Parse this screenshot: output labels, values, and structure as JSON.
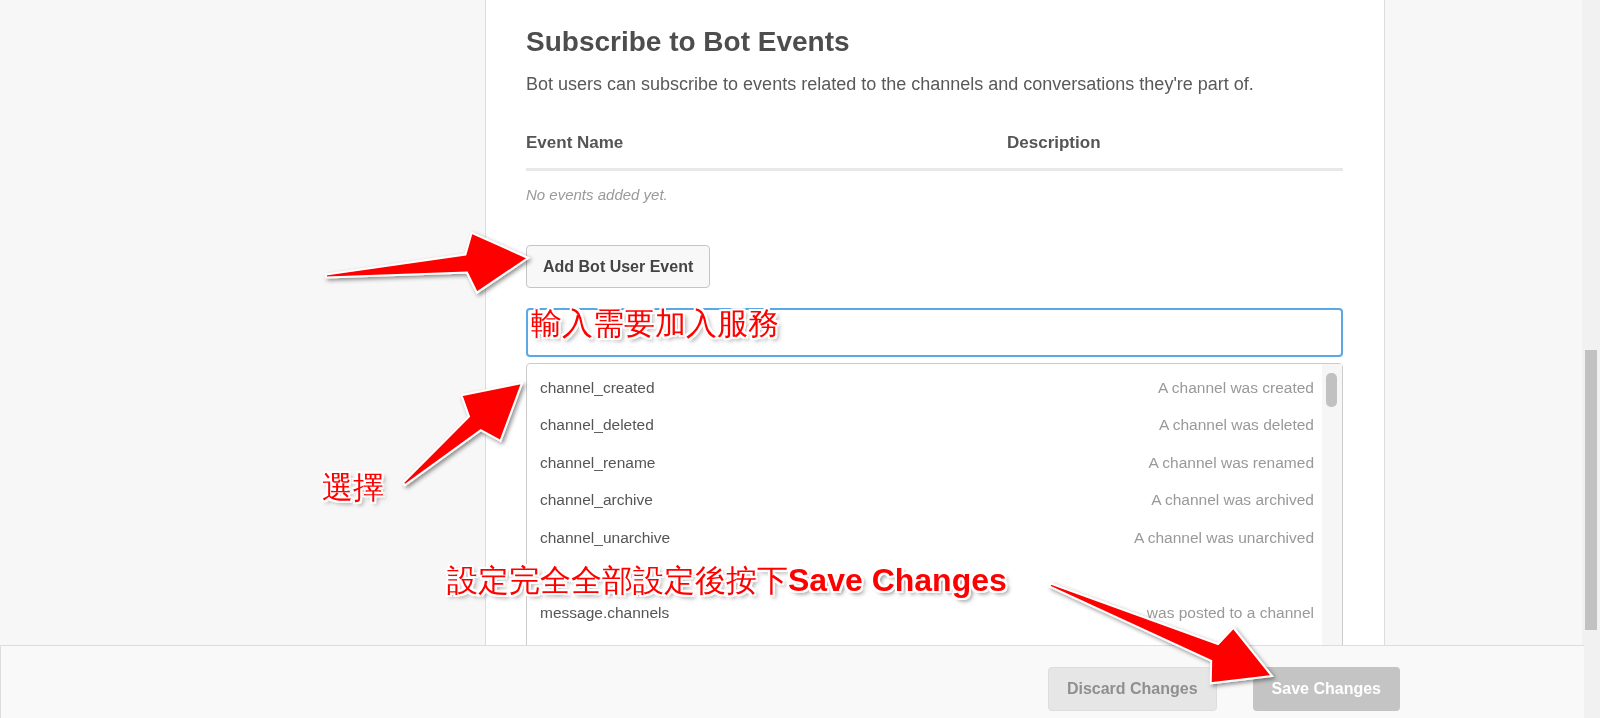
{
  "section": {
    "title": "Subscribe to Bot Events",
    "description": "Bot users can subscribe to events related to the channels and conversations they're part of."
  },
  "table": {
    "columns": [
      "Event Name",
      "Description"
    ],
    "empty_text": "No events added yet."
  },
  "add_button": {
    "label": "Add Bot User Event"
  },
  "event_options": [
    {
      "name": "channel_created",
      "description": "A channel was created"
    },
    {
      "name": "channel_deleted",
      "description": "A channel was deleted"
    },
    {
      "name": "channel_rename",
      "description": "A channel was renamed"
    },
    {
      "name": "channel_archive",
      "description": "A channel was archived"
    },
    {
      "name": "channel_unarchive",
      "description": "A channel was unarchived"
    },
    {
      "name": "message.channels",
      "description": "was posted to a channel"
    }
  ],
  "footer": {
    "buttons": [
      {
        "label": "Discard Changes",
        "kind": "secondary",
        "disabled": true
      },
      {
        "label": "Save Changes",
        "kind": "primary",
        "disabled": true
      }
    ]
  },
  "annotations": [
    {
      "text": "輸入需要加入服務"
    },
    {
      "text": "選擇"
    },
    {
      "text": "設定完全全部設定後按下**Save Changes**"
    }
  ]
}
